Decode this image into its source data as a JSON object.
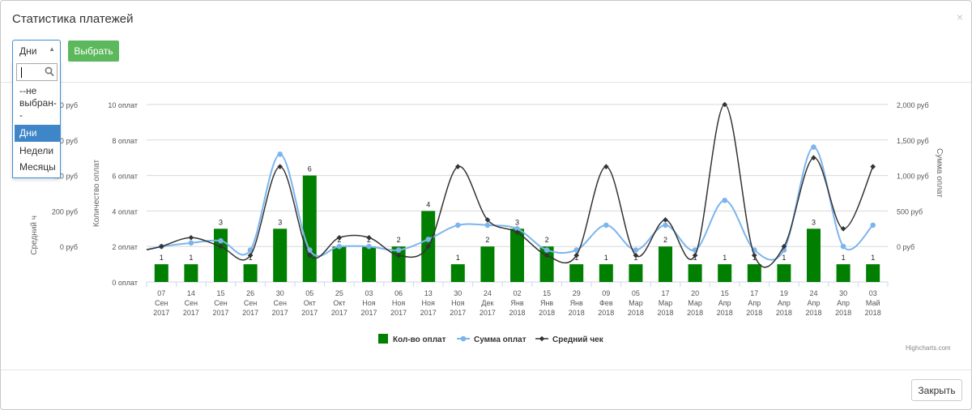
{
  "modal": {
    "title": "Статистика платежей",
    "close_symbol": "×",
    "period_select": {
      "value": "Дни",
      "options": [
        "--не выбран--",
        "Дни",
        "Недели",
        "Месяцы"
      ],
      "option_lines": [
        [
          "--не",
          "выбран-",
          "-"
        ],
        [
          "Дни"
        ],
        [
          "Недели"
        ],
        [
          "Месяцы"
        ]
      ],
      "selected_index": 1
    },
    "choose_button": "Выбрать",
    "close_button": "Закрыть"
  },
  "colors": {
    "bar": "#007f00",
    "sum_line": "#7cb5ec",
    "avg_line": "#333333",
    "select_border": "#3a8fd6",
    "green_button": "#5cb85c"
  },
  "chart_data": {
    "type": "bar",
    "categories": [
      [
        "07",
        "Сен",
        "2017"
      ],
      [
        "14",
        "Сен",
        "2017"
      ],
      [
        "15",
        "Сен",
        "2017"
      ],
      [
        "26",
        "Сен",
        "2017"
      ],
      [
        "30",
        "Сен",
        "2017"
      ],
      [
        "05",
        "Окт",
        "2017"
      ],
      [
        "25",
        "Окт",
        "2017"
      ],
      [
        "03",
        "Ноя",
        "2017"
      ],
      [
        "06",
        "Ноя",
        "2017"
      ],
      [
        "13",
        "Ноя",
        "2017"
      ],
      [
        "30",
        "Ноя",
        "2017"
      ],
      [
        "24",
        "Дек",
        "2017"
      ],
      [
        "02",
        "Янв",
        "2018"
      ],
      [
        "15",
        "Янв",
        "2018"
      ],
      [
        "29",
        "Янв",
        "2018"
      ],
      [
        "09",
        "Фев",
        "2018"
      ],
      [
        "05",
        "Мар",
        "2018"
      ],
      [
        "17",
        "Мар",
        "2018"
      ],
      [
        "20",
        "Мар",
        "2018"
      ],
      [
        "15",
        "Апр",
        "2018"
      ],
      [
        "17",
        "Апр",
        "2018"
      ],
      [
        "19",
        "Апр",
        "2018"
      ],
      [
        "24",
        "Апр",
        "2018"
      ],
      [
        "30",
        "Апр",
        "2018"
      ],
      [
        "03",
        "Май",
        "2018"
      ]
    ],
    "series": [
      {
        "name": "Кол-во оплат",
        "type": "bar",
        "axis": "count",
        "values": [
          1,
          1,
          3,
          1,
          3,
          6,
          2,
          2,
          2,
          4,
          1,
          2,
          3,
          2,
          1,
          1,
          1,
          2,
          1,
          1,
          1,
          1,
          3,
          1,
          1
        ]
      },
      {
        "name": "Сумма оплат",
        "type": "spline",
        "axis": "sum",
        "values": [
          0,
          50,
          80,
          -50,
          1300,
          -50,
          0,
          0,
          -50,
          100,
          300,
          300,
          250,
          -50,
          -50,
          300,
          -50,
          300,
          -50,
          650,
          -50,
          -50,
          1400,
          0,
          300
        ]
      },
      {
        "name": "Средний чек",
        "type": "spline",
        "axis": "avg",
        "values": [
          0,
          50,
          0,
          -50,
          450,
          -50,
          50,
          50,
          -50,
          0,
          450,
          150,
          80,
          -50,
          -50,
          450,
          -50,
          150,
          -50,
          800,
          -50,
          0,
          500,
          100,
          450
        ]
      }
    ],
    "axes": {
      "count": {
        "title": "Количество оплат",
        "ticks": [
          "0 оплат",
          "2 оплат",
          "4 оплат",
          "6 оплат",
          "8 оплат",
          "10 оплат"
        ],
        "min": 0,
        "max": 10
      },
      "avg": {
        "title": "Средний ч",
        "visible_ticks": [
          "0 руб",
          "200 руб",
          "400 руб"
        ],
        "clipped_ticks": [
          "0 руб",
          "0 руб"
        ],
        "min": -200,
        "max": 800
      },
      "sum": {
        "title": "Сумма оплат",
        "ticks": [
          "0 руб",
          "500 руб",
          "1,000 руб",
          "1,500 руб",
          "2,000 руб"
        ],
        "min": -500,
        "max": 2000
      }
    },
    "legend": [
      "Кол-во оплат",
      "Сумма оплат",
      "Средний чек"
    ],
    "legend_position": "bottom-center",
    "grid": true,
    "credits": "Highcharts.com"
  }
}
